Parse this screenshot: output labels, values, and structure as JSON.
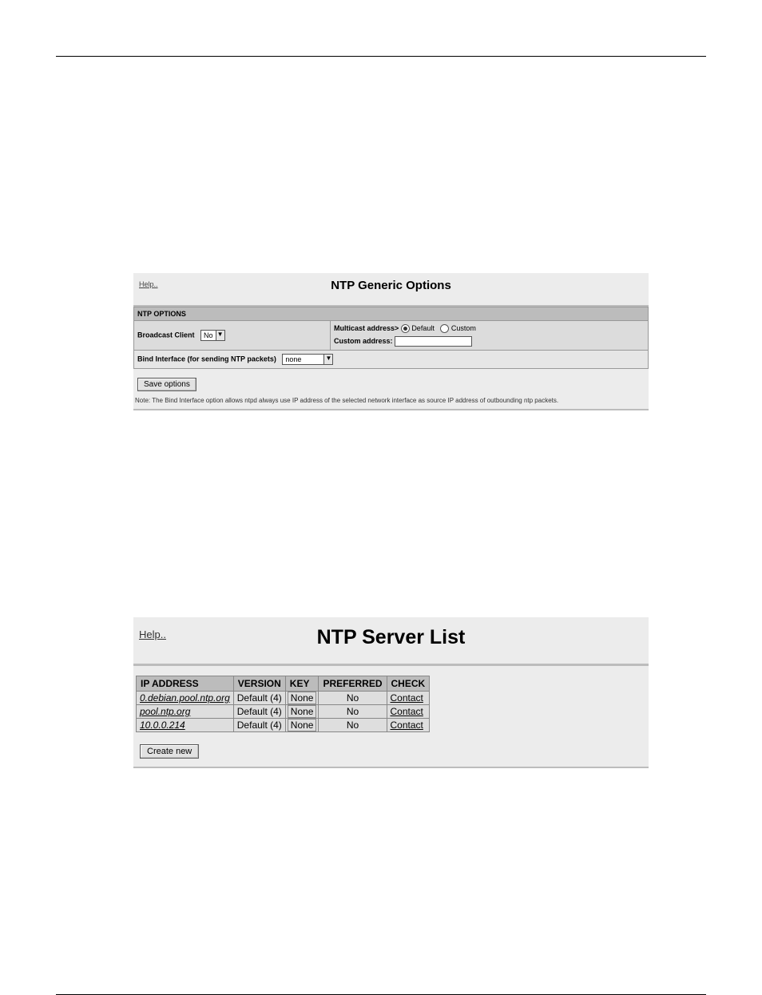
{
  "panel1": {
    "help": "Help..",
    "title": "NTP Generic Options",
    "section_header": "NTP OPTIONS",
    "broadcast_label": "Broadcast Client",
    "broadcast_value": "No",
    "multicast_label": "Multicast address>",
    "radio_default": "Default",
    "radio_custom": "Custom",
    "custom_addr_label": "Custom address:",
    "bind_label": "Bind Interface (for sending NTP packets)",
    "bind_value": "none",
    "save_btn": "Save options",
    "note": "Note: The Bind Interface option allows ntpd always use IP address of the selected network interface as source IP address of outbounding ntp packets."
  },
  "panel2": {
    "help": "Help..",
    "title": "NTP Server List",
    "headers": {
      "ip": "IP ADDRESS",
      "version": "VERSION",
      "key": "KEY",
      "preferred": "PREFERRED",
      "check": "CHECK"
    },
    "rows": [
      {
        "ip": "0.debian.pool.ntp.org",
        "version": "Default (4)",
        "key": "None",
        "preferred": "No",
        "check": "Contact"
      },
      {
        "ip": "pool.ntp.org",
        "version": "Default (4)",
        "key": "None",
        "preferred": "No",
        "check": "Contact"
      },
      {
        "ip": "10.0.0.214",
        "version": "Default (4)",
        "key": "None",
        "preferred": "No",
        "check": "Contact"
      }
    ],
    "create_btn": "Create new"
  }
}
